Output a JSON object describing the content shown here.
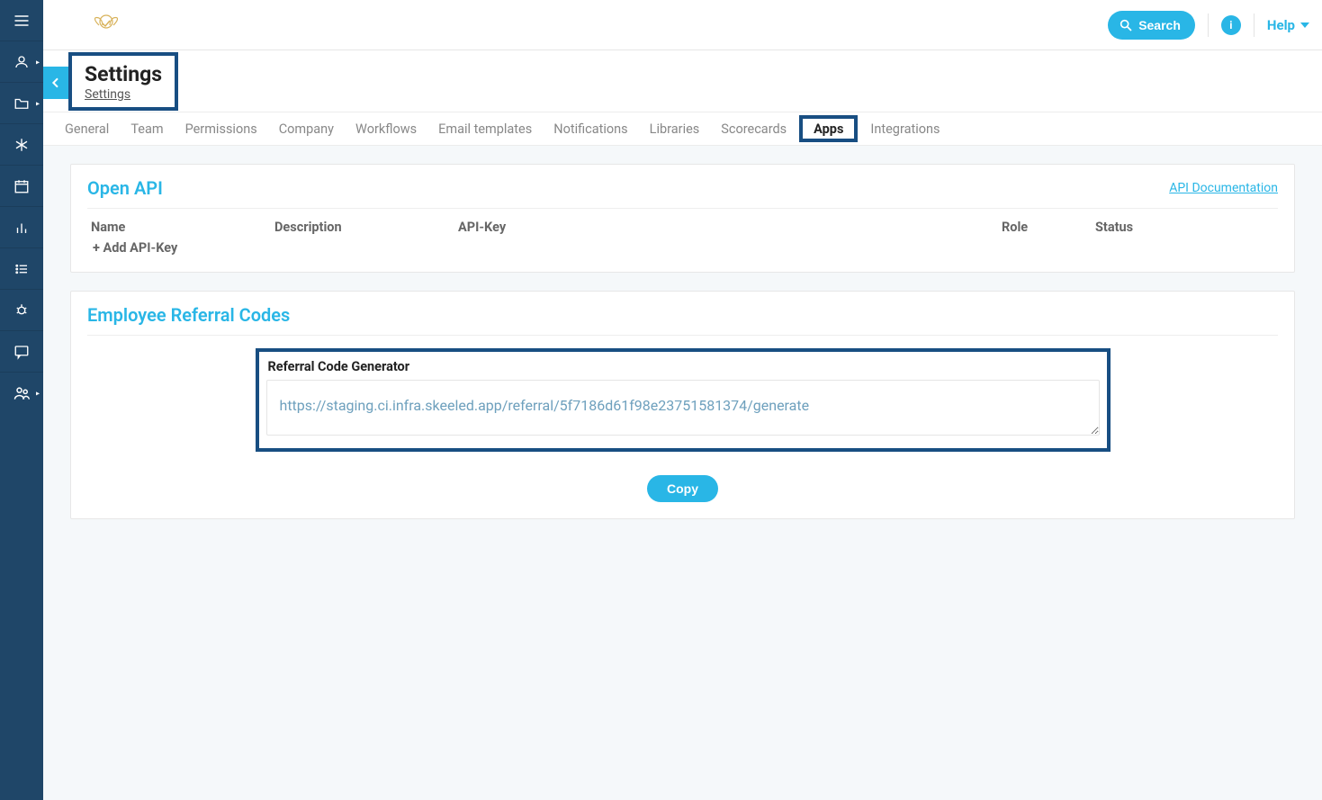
{
  "topbar": {
    "search_label": "Search",
    "info_label": "i",
    "help_label": "Help"
  },
  "heading": {
    "title": "Settings",
    "subtitle": "Settings"
  },
  "tabs": {
    "items": [
      {
        "label": "General"
      },
      {
        "label": "Team"
      },
      {
        "label": "Permissions"
      },
      {
        "label": "Company"
      },
      {
        "label": "Workflows"
      },
      {
        "label": "Email templates"
      },
      {
        "label": "Notifications"
      },
      {
        "label": "Libraries"
      },
      {
        "label": "Scorecards"
      },
      {
        "label": "Apps",
        "active": true
      },
      {
        "label": "Integrations"
      }
    ]
  },
  "open_api": {
    "title": "Open API",
    "doc_link": "API Documentation",
    "col_name": "Name",
    "col_description": "Description",
    "col_key": "API-Key",
    "col_role": "Role",
    "col_status": "Status",
    "add_label": "+ Add API-Key"
  },
  "referral": {
    "card_title": "Employee Referral Codes",
    "box_title": "Referral Code Generator",
    "url_value": "https://staging.ci.infra.skeeled.app/referral/5f7186d61f98e23751581374/generate",
    "copy_label": "Copy"
  }
}
